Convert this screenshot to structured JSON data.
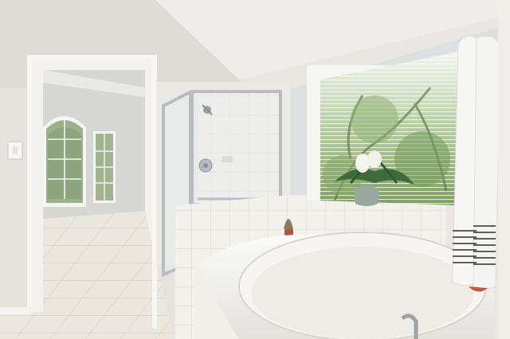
{
  "scene": {
    "colors": {
      "wall": "#e4e3de",
      "ceiling": "#eeede9",
      "accent_wall": "#cfdcdf",
      "tile": "#f2f1ec",
      "grout": "#d7d5cf",
      "floor": "#ebe7df",
      "tub": "#f6f5f1",
      "glass": "#e6ebec",
      "frame_metal": "#b9bdbf",
      "greenery": "#7fa060",
      "towel": "#f7f7f5",
      "towel_stripe": "#2e2e2e"
    },
    "icons": [
      "shower-head-icon",
      "shower-valve-icon",
      "faucet-spout-icon",
      "light-switch-icon",
      "towel-bar-icon"
    ]
  }
}
